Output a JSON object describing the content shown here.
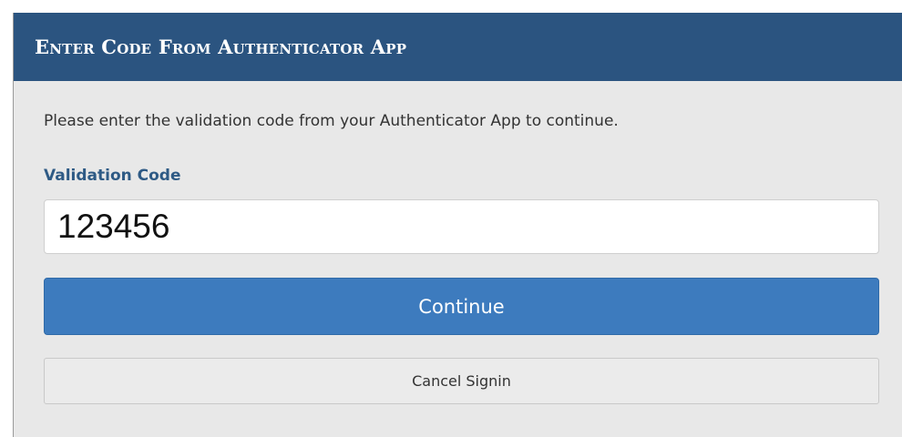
{
  "panel": {
    "title": "Enter Code From Authenticator App",
    "instructions": "Please enter the validation code from your Authenticator App to continue.",
    "field_label": "Validation Code",
    "code_value": "123456",
    "continue_label": "Continue",
    "cancel_label": "Cancel Signin"
  },
  "colors": {
    "header_bg": "#2b5480",
    "panel_bg": "#e8e8e8",
    "label_text": "#2e5a85",
    "primary_button": "#3d7bbe",
    "secondary_button": "#ebebeb"
  }
}
